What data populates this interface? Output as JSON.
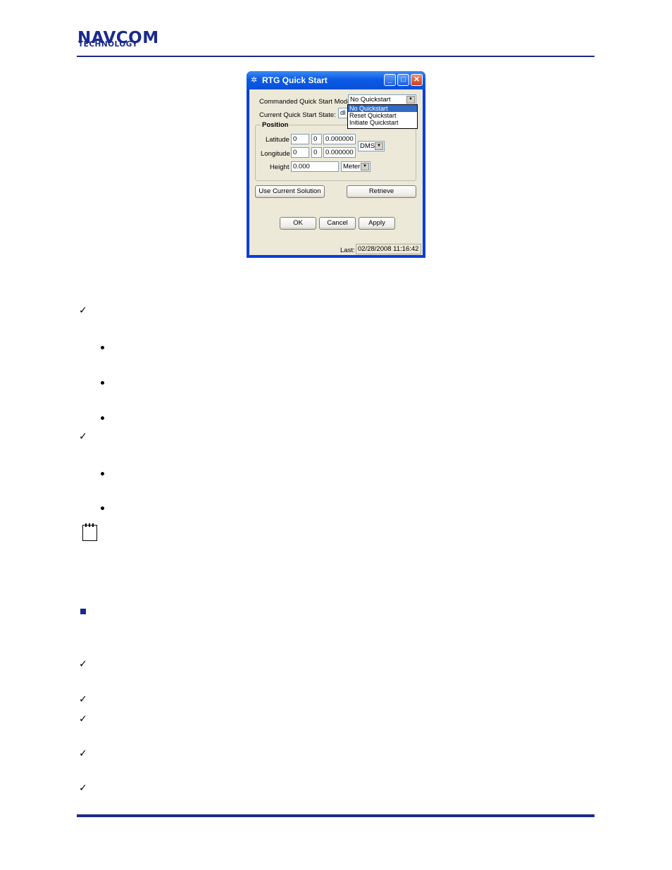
{
  "header": {
    "logo_top": "NAVCOM",
    "logo_bottom": "TECHNOLOGY"
  },
  "dialog": {
    "title": "RTG Quick Start",
    "commanded_mode_label": "Commanded Quick Start Mode:",
    "commanded_mode_value": "No Quickstart",
    "dropdown_options": [
      "No Quickstart",
      "Reset Quickstart",
      "Initiate Quickstart"
    ],
    "current_state_label": "Current Quick Start State:",
    "current_state_value": "dl",
    "position_group_label": "Position",
    "latitude_label": "Latitude",
    "latitude": {
      "deg": "0",
      "min": "0",
      "sec": "0.000000"
    },
    "longitude_label": "Longitude",
    "longitude": {
      "deg": "0",
      "min": "0",
      "sec": "0.000000"
    },
    "format_value": "DMS",
    "height_label": "Height",
    "height_value": "0.000",
    "height_unit": "Meter",
    "use_current_solution_label": "Use Current Solution",
    "retrieve_label": "Retrieve",
    "ok_label": "OK",
    "cancel_label": "Cancel",
    "apply_label": "Apply",
    "last_label": "Last:",
    "last_value": "02/28/2008 11:16:42"
  }
}
